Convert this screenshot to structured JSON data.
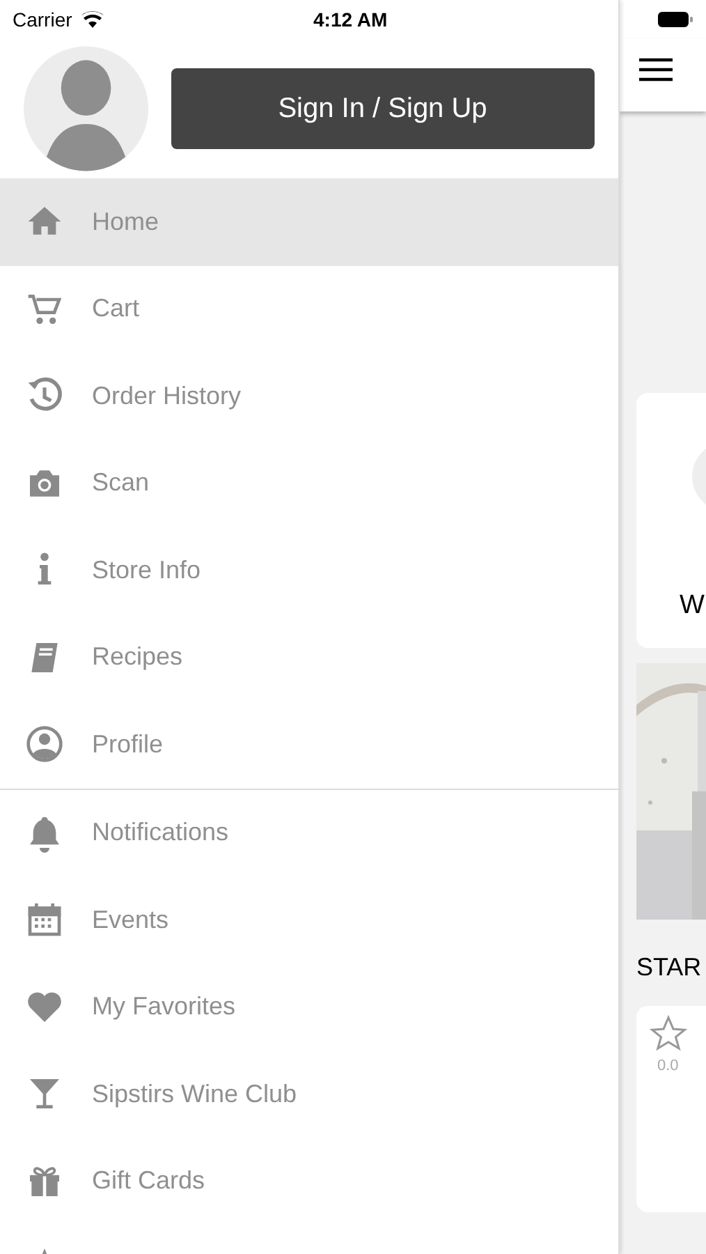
{
  "status_bar": {
    "carrier": "Carrier",
    "time": "4:12 AM"
  },
  "drawer": {
    "sign_in_button": "Sign In / Sign Up",
    "sections": [
      {
        "items": [
          {
            "label": "Home",
            "selected": true
          },
          {
            "label": "Cart",
            "selected": false
          },
          {
            "label": "Order History",
            "selected": false
          },
          {
            "label": "Scan",
            "selected": false
          },
          {
            "label": "Store Info",
            "selected": false
          },
          {
            "label": "Recipes",
            "selected": false
          },
          {
            "label": "Profile",
            "selected": false
          }
        ]
      },
      {
        "items": [
          {
            "label": "Notifications",
            "selected": false
          },
          {
            "label": "Events",
            "selected": false
          },
          {
            "label": "My Favorites",
            "selected": false
          },
          {
            "label": "Sipstirs Wine Club",
            "selected": false
          },
          {
            "label": "Gift Cards",
            "selected": false
          },
          {
            "selected": false
          }
        ]
      }
    ]
  },
  "background_page": {
    "card_text": "W",
    "section_title": "STAR",
    "rating": "0.0"
  }
}
